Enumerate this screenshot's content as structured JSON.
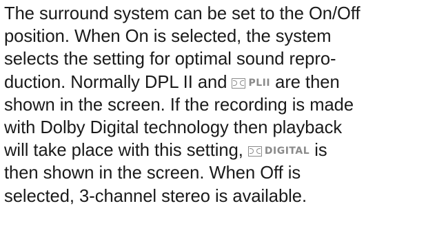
{
  "paragraph": {
    "line1": "The surround system can be set to the On/Off",
    "line2": "position. When On is selected, the system",
    "line3": "selects the setting for optimal sound repro-",
    "line4_before": "duction. Normally DPL II and ",
    "line4_logo": "PLII",
    "line4_after": " are then",
    "line5": "shown in the screen. If the recording is made",
    "line6": "with Dolby Digital technology then playback",
    "line7_before": "will take place with this setting, ",
    "line7_logo": "DIGITAL",
    "line7_after": " is",
    "line8": "then shown in the screen. When Off is",
    "line9": "selected, 3-channel stereo is available."
  },
  "colors": {
    "text": "#1a1a1a",
    "logo": "#8a8a8a",
    "background": "#ffffff"
  },
  "icons": {
    "dolby_pl2_logo": "dolby-pro-logic-ii-icon",
    "dolby_digital_logo": "dolby-digital-icon"
  }
}
